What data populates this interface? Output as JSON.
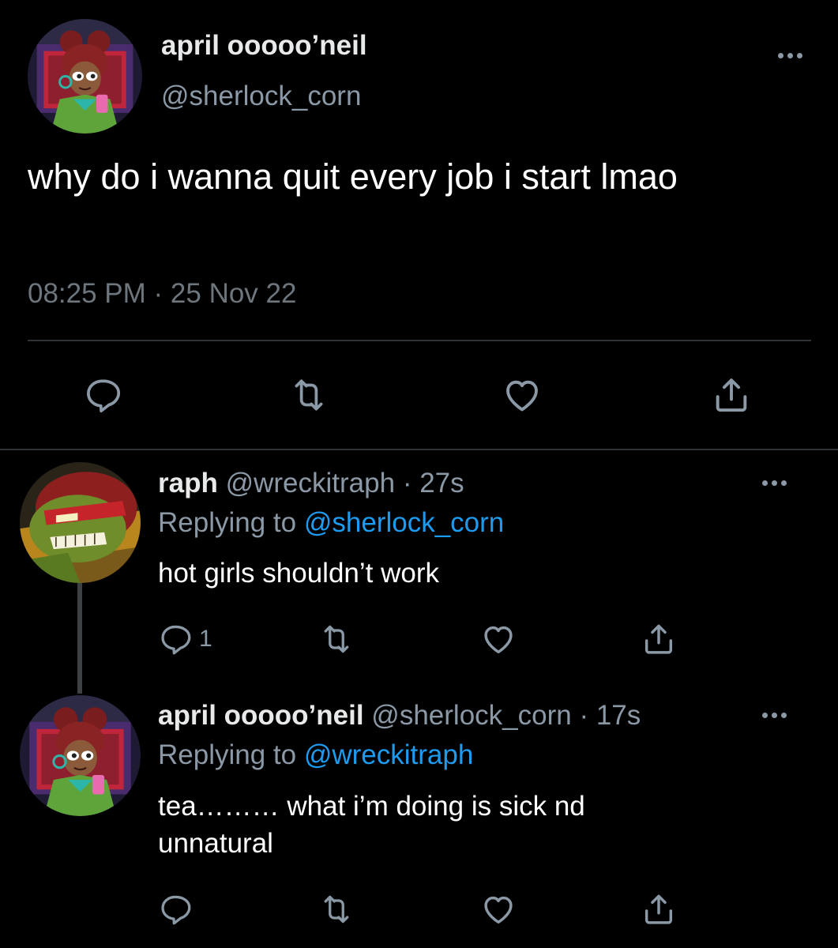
{
  "main_tweet": {
    "display_name": "april ooooo’neil",
    "handle": "@sherlock_corn",
    "text": "why do i wanna quit every job i start lmao",
    "timestamp": "08:25 PM · 25 Nov 22",
    "avatar_icon": "april-avatar-icon",
    "actions": [
      "reply-icon",
      "retweet-icon",
      "like-icon",
      "share-icon"
    ]
  },
  "replies": [
    {
      "display_name": "raph",
      "handle": "@wreckitraph",
      "time": "· 27s",
      "replying_prefix": "Replying to",
      "replying_to": "@sherlock_corn",
      "text": "hot girls shouldn’t work",
      "reply_count": "1",
      "avatar_icon": "raph-avatar-icon"
    },
    {
      "display_name": "april ooooo’neil",
      "handle": "@sherlock_corn",
      "time": "· 17s",
      "replying_prefix": "Replying to",
      "replying_to": "@wreckitraph",
      "text": "tea……… what i’m doing is sick nd unnatural",
      "reply_count": "",
      "avatar_icon": "april-avatar-icon"
    }
  ],
  "colors": {
    "background": "#000000",
    "primary_text": "#e7e9ea",
    "secondary_text": "#8b98a5",
    "mention": "#1d9bf0",
    "divider": "#2f3336"
  }
}
